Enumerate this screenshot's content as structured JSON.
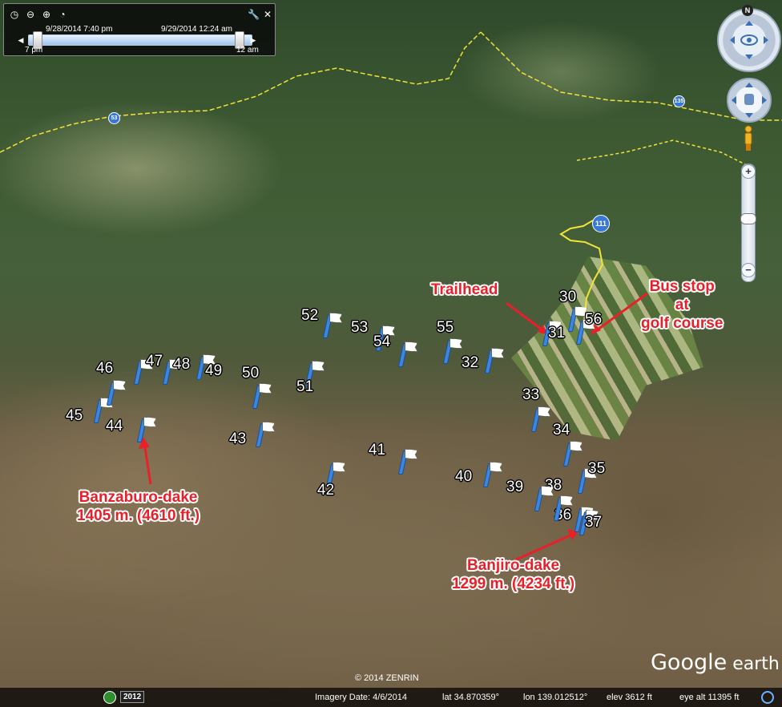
{
  "time_slider": {
    "start_label": "9/28/2014  7:40 pm",
    "end_label": "9/29/2014  12:24 am",
    "min_label": "7 pm",
    "max_label": "12 am"
  },
  "nav": {
    "north_label": "N",
    "route_111": "111",
    "route_53": "53",
    "route_135": "135"
  },
  "markers": [
    {
      "n": "30"
    },
    {
      "n": "31"
    },
    {
      "n": "56"
    },
    {
      "n": "32"
    },
    {
      "n": "33"
    },
    {
      "n": "34"
    },
    {
      "n": "35"
    },
    {
      "n": "36"
    },
    {
      "n": "37"
    },
    {
      "n": "38"
    },
    {
      "n": "39"
    },
    {
      "n": "40"
    },
    {
      "n": "41"
    },
    {
      "n": "42"
    },
    {
      "n": "43"
    },
    {
      "n": "44"
    },
    {
      "n": "45"
    },
    {
      "n": "46"
    },
    {
      "n": "47"
    },
    {
      "n": "48"
    },
    {
      "n": "49"
    },
    {
      "n": "50"
    },
    {
      "n": "51"
    },
    {
      "n": "52"
    },
    {
      "n": "53"
    },
    {
      "n": "54"
    },
    {
      "n": "55"
    }
  ],
  "annotations": {
    "trailhead": "Trailhead",
    "bus_stop": "Bus stop\nat\ngolf course",
    "banzaburo": "Banzaburo-dake\n1405 m. (4610 ft.)",
    "banjiro": "Banjiro-dake\n1299 m. (4234 ft.)"
  },
  "footer": {
    "copyright": "© 2014 ZENRIN",
    "logo_main": "Google",
    "logo_sub": " earth",
    "year": "2012",
    "imagery_date": "Imagery Date: 4/6/2014",
    "lat": "lat   34.870359°",
    "lon": "lon  139.012512°",
    "elev": "elev  3612 ft",
    "eye_alt": "eye alt  11395 ft"
  },
  "colors": {
    "annotation": "#e8202a",
    "flag_pole": "#3a86e0",
    "road": "#f2e23a"
  }
}
